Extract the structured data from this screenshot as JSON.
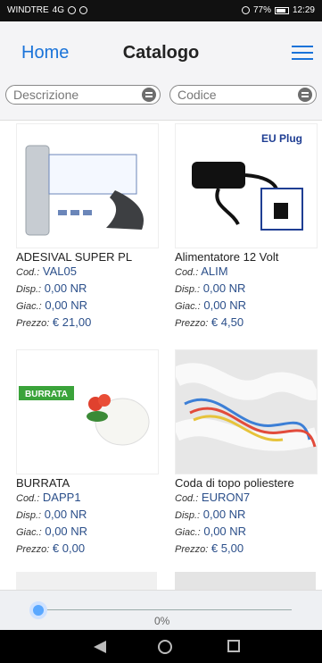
{
  "statusbar": {
    "carrier": "WINDTRE",
    "network": "4G",
    "battery": "77%",
    "time": "12:29"
  },
  "header": {
    "home": "Home",
    "title": "Catalogo"
  },
  "search": {
    "description_placeholder": "Descrizione",
    "code_placeholder": "Codice"
  },
  "labels": {
    "cod": "Cod.:",
    "disp": "Disp.:",
    "giac": "Giac.:",
    "prezzo": "Prezzo:"
  },
  "products": [
    {
      "name": "ADESIVAL SUPER PL",
      "cod": "VAL05",
      "disp": "0,00 NR",
      "giac": "0,00 NR",
      "prezzo": "€ 21,00"
    },
    {
      "name": "Alimentatore 12 Volt",
      "cod": "ALIM",
      "disp": "0,00 NR",
      "giac": "0,00 NR",
      "prezzo": "€ 4,50",
      "badge": "EU Plug"
    },
    {
      "name": "BURRATA",
      "cod": "DAPP1",
      "disp": "0,00 NR",
      "giac": "0,00 NR",
      "prezzo": "€ 0,00",
      "badge": "BURRATA"
    },
    {
      "name": "Coda di topo poliestere",
      "cod": "EURON7",
      "disp": "0,00 NR",
      "giac": "0,00 NR",
      "prezzo": "€ 5,00"
    }
  ],
  "slider": {
    "value_text": "0%",
    "value": 0
  },
  "colors": {
    "accent": "#1a73d9",
    "value_blue": "#2b4f8a"
  }
}
